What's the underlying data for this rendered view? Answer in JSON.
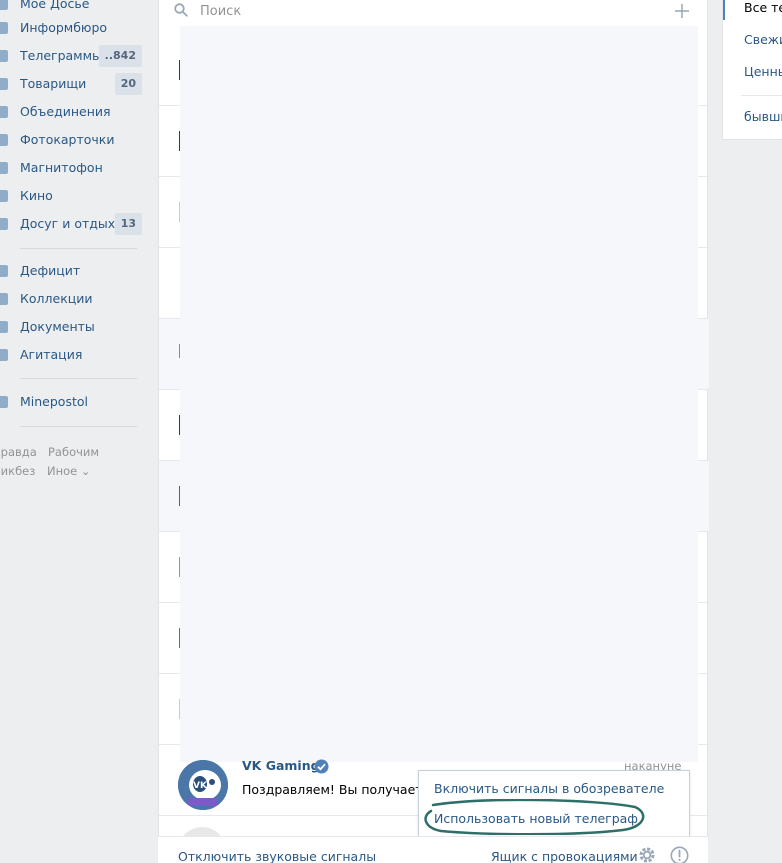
{
  "sidebar": {
    "items": [
      {
        "label": "Мое Досье",
        "counter": ""
      },
      {
        "label": "Информбюро",
        "counter": ""
      },
      {
        "label": "Телеграммы",
        "counter": "..842"
      },
      {
        "label": "Товарищи",
        "counter": "20"
      },
      {
        "label": "Объединения",
        "counter": ""
      },
      {
        "label": "Фотокарточки",
        "counter": ""
      },
      {
        "label": "Магнитофон",
        "counter": ""
      },
      {
        "label": "Кино",
        "counter": ""
      },
      {
        "label": "Досуг и отдых",
        "counter": "13"
      },
      {
        "label": "Дефицит",
        "counter": ""
      },
      {
        "label": "Коллекции",
        "counter": ""
      },
      {
        "label": "Документы",
        "counter": ""
      },
      {
        "label": "Агитация",
        "counter": ""
      },
      {
        "label": "Minepostol",
        "counter": ""
      }
    ],
    "footer": {
      "pravda": "Правда",
      "rabochim": "Рабочим",
      "likbez": "Ликбез",
      "inoe": "Иное ⌄"
    }
  },
  "main": {
    "search": {
      "placeholder": "Поиск",
      "value": ""
    },
    "dialog": {
      "name": "VK Gaming",
      "preview": "Поздравляем! Вы получаете",
      "time": "накануне"
    },
    "popup": {
      "item1": "Включить сигналы в обозревателе",
      "item2": "Использовать новый телеграф"
    },
    "bottom": {
      "mute": "Отключить звуковые сигналы",
      "provocation": "Ящик с провокациями"
    }
  },
  "filters": {
    "items": [
      "Все те",
      "Свежи",
      "Ценны",
      "бывши"
    ]
  },
  "colors": {
    "link": "#2a5885",
    "background": "#edeef0",
    "annotation": "#2e6f6a"
  }
}
